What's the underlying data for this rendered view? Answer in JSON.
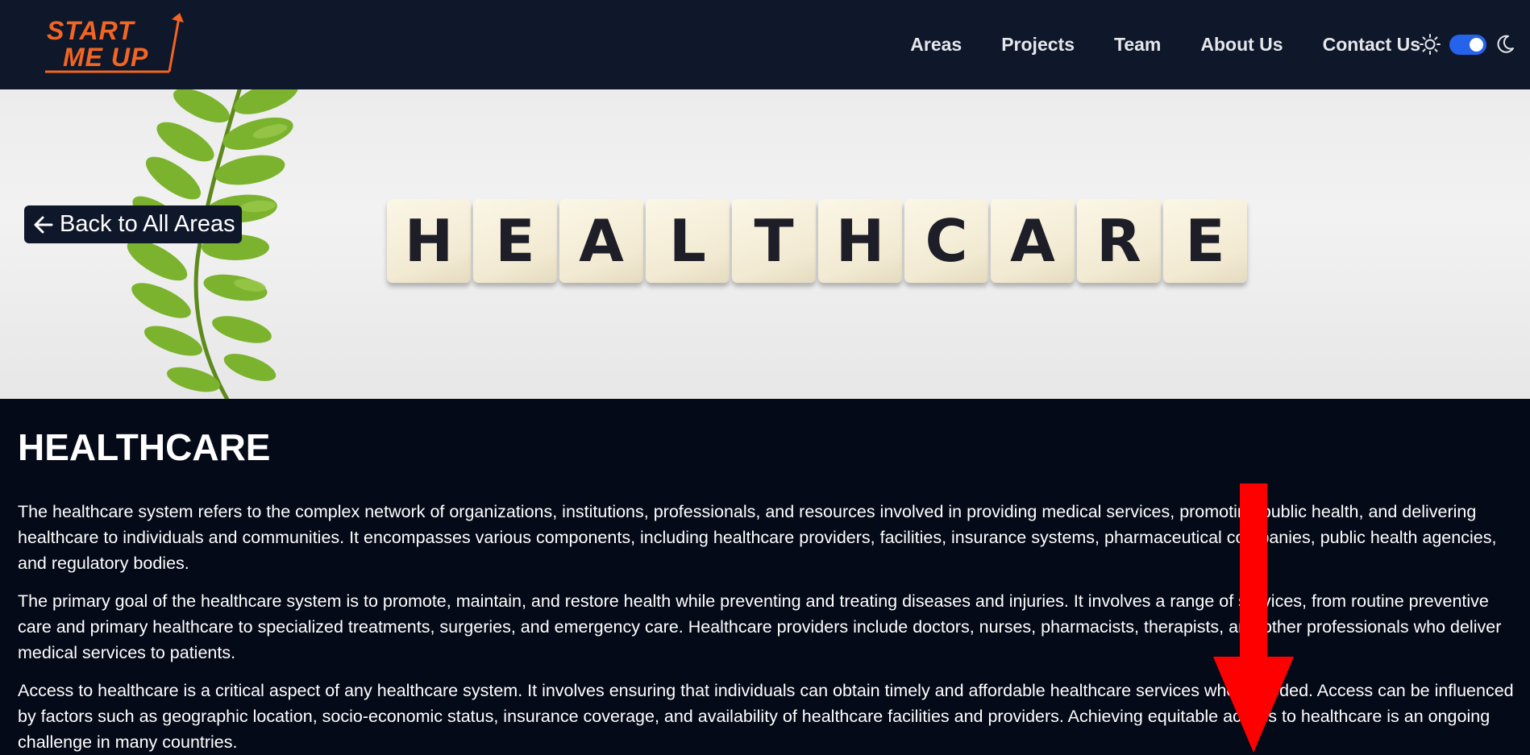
{
  "logo": {
    "line1": "START",
    "line2": "ME UP"
  },
  "nav": {
    "items": [
      {
        "label": "Areas"
      },
      {
        "label": "Projects"
      },
      {
        "label": "Team"
      },
      {
        "label": "About Us"
      },
      {
        "label": "Contact Us"
      }
    ]
  },
  "theme": {
    "icons": [
      "sun-icon",
      "moon-icon"
    ],
    "dark_mode_enabled": true,
    "accent": "#2563eb"
  },
  "hero": {
    "tiles": [
      "H",
      "E",
      "A",
      "L",
      "T",
      "H",
      "C",
      "A",
      "R",
      "E"
    ],
    "back_label": "Back to All Areas"
  },
  "main": {
    "title": "HEALTHCARE",
    "paragraphs": [
      "The healthcare system refers to the complex network of organizations, institutions, professionals, and resources involved in providing medical services, promoting public health, and delivering healthcare to individuals and communities. It encompasses various components, including healthcare providers, facilities, insurance systems, pharmaceutical companies, public health agencies, and regulatory bodies.",
      "The primary goal of the healthcare system is to promote, maintain, and restore health while preventing and treating diseases and injuries. It involves a range of services, from routine preventive care and primary healthcare to specialized treatments, surgeries, and emergency care. Healthcare providers include doctors, nurses, pharmacists, therapists, and other professionals who deliver medical services to patients.",
      "Access to healthcare is a critical aspect of any healthcare system. It involves ensuring that individuals can obtain timely and affordable healthcare services when needed. Access can be influenced by factors such as geographic location, socio-economic status, insurance coverage, and availability of healthcare facilities and providers. Achieving equitable access to healthcare is an ongoing challenge in many countries."
    ]
  },
  "colors": {
    "header_bg": "#0f172a",
    "page_bg": "#050a18",
    "logo_orange": "#f26522",
    "arrow_red": "#ff0000"
  }
}
